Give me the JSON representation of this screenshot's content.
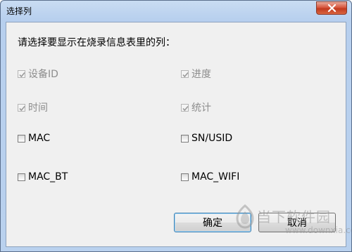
{
  "window": {
    "title": "选择列"
  },
  "prompt": "请选择要显示在烧录信息表里的列：",
  "options": [
    {
      "label": "设备ID",
      "checked": true,
      "disabled": true
    },
    {
      "label": "进度",
      "checked": true,
      "disabled": true
    },
    {
      "label": "时间",
      "checked": true,
      "disabled": true
    },
    {
      "label": "统计",
      "checked": true,
      "disabled": true
    },
    {
      "label": "MAC",
      "checked": false,
      "disabled": false
    },
    {
      "label": "SN/USID",
      "checked": false,
      "disabled": false
    },
    {
      "label": "MAC_BT",
      "checked": false,
      "disabled": false
    },
    {
      "label": "MAC_WIFI",
      "checked": false,
      "disabled": false
    }
  ],
  "buttons": {
    "ok": "确定",
    "cancel": "取消"
  },
  "watermark": {
    "text": "当下软件园",
    "sub": "www.downxia.com"
  }
}
